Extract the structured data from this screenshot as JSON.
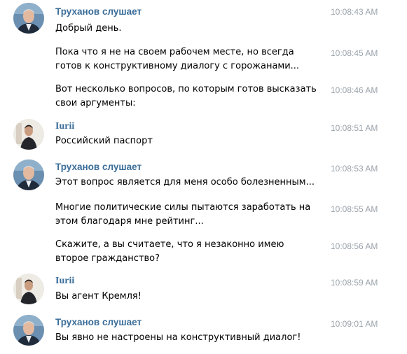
{
  "messages": {
    "g1": {
      "sender": "Труханов слушает",
      "lines": [
        {
          "text": "Добрый день.",
          "time": "10:08:43 AM"
        },
        {
          "text": "Пока что я не на своем рабочем месте, но всегда готов к конструктивному диалогу с горожанами...",
          "time": "10:08:45 AM"
        },
        {
          "text": "Вот несколько вопросов, по которым готов высказать свои аргументы:",
          "time": "10:08:46 AM"
        }
      ]
    },
    "g2": {
      "sender": "Iurii",
      "lines": [
        {
          "text": "Российский паспорт",
          "time": "10:08:51 AM"
        }
      ]
    },
    "g3": {
      "sender": "Труханов слушает",
      "lines": [
        {
          "text": "Этот вопрос является для меня особо болезненным...",
          "time": "10:08:53 AM"
        },
        {
          "text": "Многие политические силы пытаются заработать на этом благодаря мне рейтинг...",
          "time": "10:08:55 AM"
        },
        {
          "text": "Скажите, а вы считаете, что я незаконно имею второе гражданство?",
          "time": "10:08:56 AM"
        }
      ]
    },
    "g4": {
      "sender": "Iurii",
      "lines": [
        {
          "text": "Вы агент Кремля!",
          "time": "10:08:59 AM"
        }
      ]
    },
    "g5": {
      "sender": "Труханов слушает",
      "lines": [
        {
          "text": "Вы явно не настроены на конструктивный диалог!",
          "time": "10:09:01 AM"
        }
      ]
    }
  },
  "colors": {
    "sender_name": "#3a6d99",
    "timestamp": "#9aa3ab",
    "message_text": "#000000"
  },
  "icons": {
    "bot_avatar": "avatar-bot-icon",
    "user_avatar": "avatar-user-icon"
  }
}
